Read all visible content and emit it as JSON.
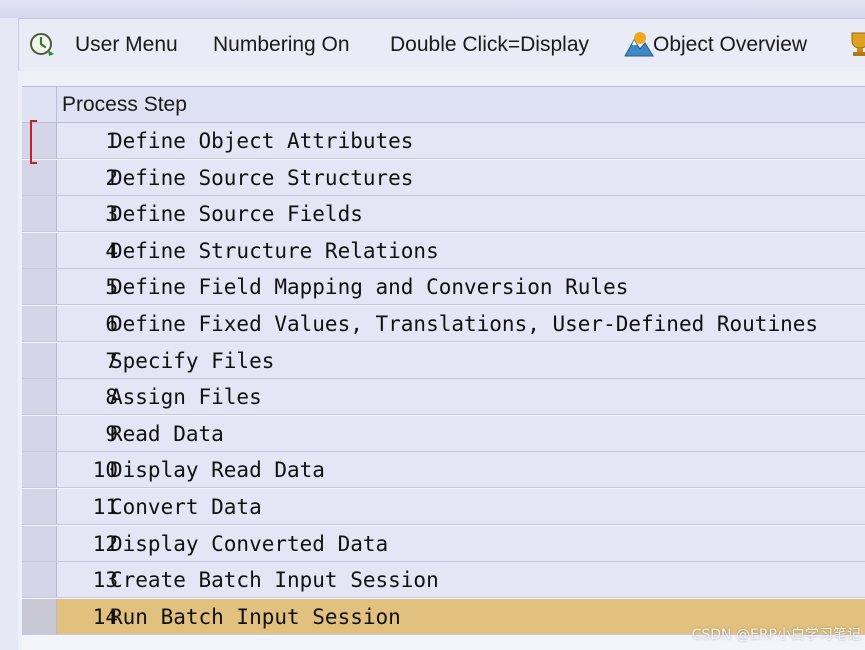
{
  "toolbar": {
    "items": [
      {
        "label": "User Menu",
        "icon": "clock-arrow-icon"
      },
      {
        "label": "Numbering On"
      },
      {
        "label": "Double Click=Display"
      },
      {
        "label": "Object Overview",
        "icon": "mountain-overview-icon"
      }
    ],
    "trailing_icon": "trophy-icon"
  },
  "table": {
    "header": "Process Step",
    "rows": [
      {
        "num": "1",
        "text": "Define Object Attributes"
      },
      {
        "num": "2",
        "text": "Define Source Structures"
      },
      {
        "num": "3",
        "text": "Define Source Fields"
      },
      {
        "num": "4",
        "text": "Define Structure Relations"
      },
      {
        "num": "5",
        "text": "Define Field Mapping and Conversion Rules"
      },
      {
        "num": "6",
        "text": "Define Fixed Values, Translations, User-Defined Routines"
      },
      {
        "num": "7",
        "text": "Specify Files"
      },
      {
        "num": "8",
        "text": "Assign Files"
      },
      {
        "num": "9",
        "text": "Read Data"
      },
      {
        "num": "10",
        "text": "Display Read Data"
      },
      {
        "num": "11",
        "text": "Convert Data"
      },
      {
        "num": "12",
        "text": "Display Converted Data"
      },
      {
        "num": "13",
        "text": "Create Batch Input Session"
      },
      {
        "num": "14",
        "text": "Run Batch Input Session"
      }
    ],
    "highlighted_row": 14
  },
  "watermark": "CSDN @ERP小白学习笔记",
  "colors": {
    "row_bg": "#e4e5f5",
    "highlight_bg": "#e2c17e",
    "header_bg": "#dfe2f2",
    "focus_marker": "#c0202a"
  }
}
